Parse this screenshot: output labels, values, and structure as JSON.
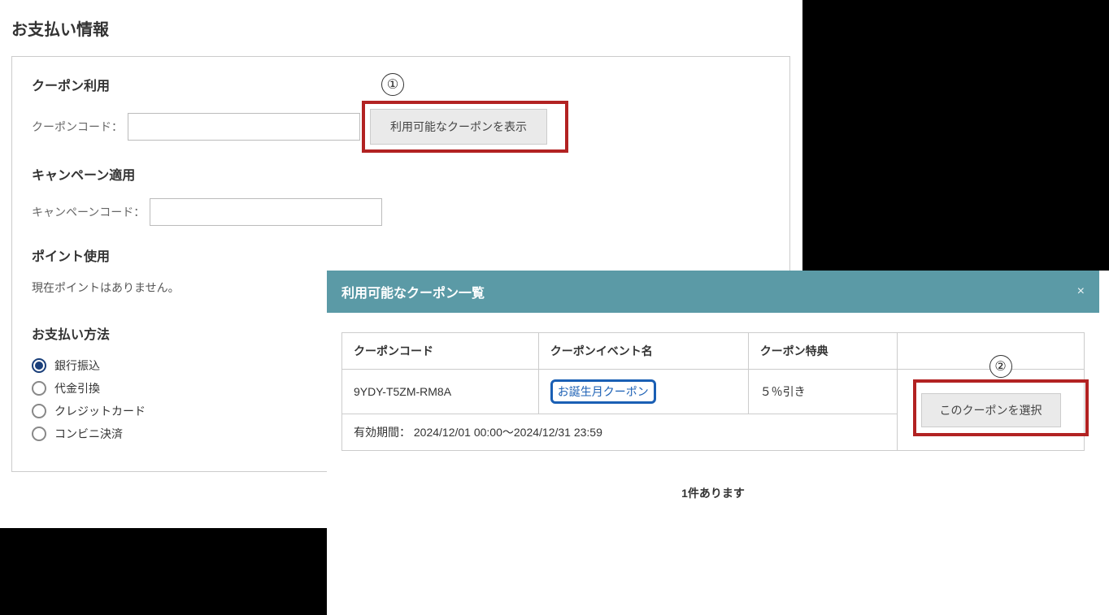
{
  "page": {
    "title": "お支払い情報"
  },
  "coupon": {
    "heading": "クーポン利用",
    "code_label": "クーポンコード：",
    "show_button": "利用可能なクーポンを表示",
    "annotation_number": "①"
  },
  "campaign": {
    "heading": "キャンペーン適用",
    "code_label": "キャンペーンコード："
  },
  "points": {
    "heading": "ポイント使用",
    "none_msg": "現在ポイントはありません。"
  },
  "pay": {
    "heading": "お支払い方法",
    "options": [
      {
        "label": "銀行振込",
        "selected": true
      },
      {
        "label": "代金引換",
        "selected": false
      },
      {
        "label": "クレジットカード",
        "selected": false
      },
      {
        "label": "コンビニ決済",
        "selected": false
      }
    ]
  },
  "modal": {
    "title": "利用可能なクーポン一覧",
    "close_glyph": "×",
    "headers": {
      "code": "クーポンコード",
      "event": "クーポンイベント名",
      "benefit": "クーポン特典",
      "action": ""
    },
    "row": {
      "code": "9YDY-T5ZM-RM8A",
      "event": "お誕生月クーポン",
      "benefit": "５％引き",
      "select_label": "このクーポンを選択",
      "validity": "有効期間： 2024/12/01 00:00～2024/12/31 23:59",
      "annotation_number": "②"
    },
    "count_text": "1件あります"
  }
}
